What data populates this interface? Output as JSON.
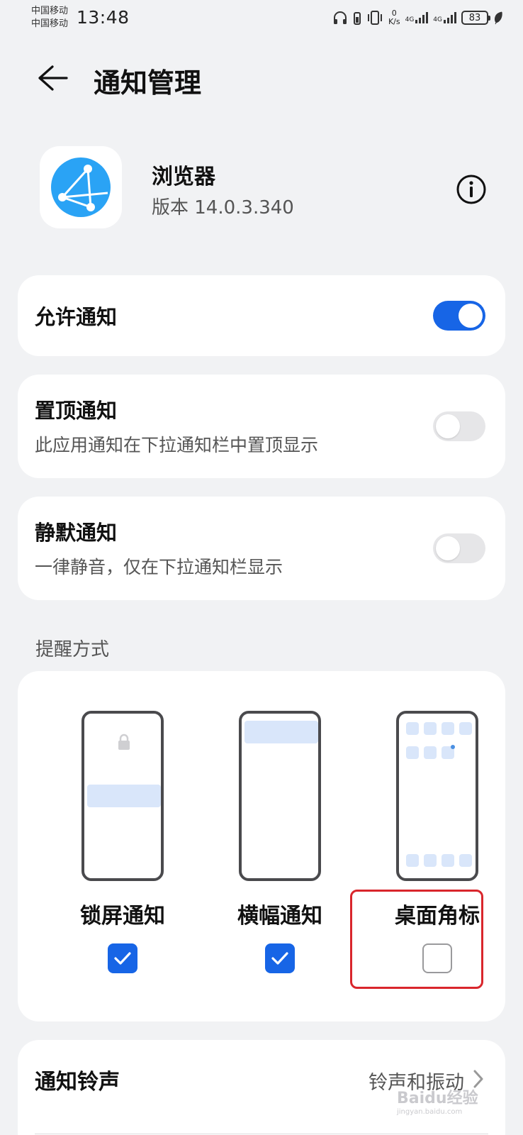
{
  "status_bar": {
    "carrier_1": "中国移动",
    "carrier_2": "中国移动",
    "time": "13:48",
    "net_speed_value": "0",
    "net_speed_unit": "K/s",
    "network_1": "4G",
    "network_2": "4G",
    "battery": "83"
  },
  "header": {
    "title": "通知管理"
  },
  "app": {
    "name": "浏览器",
    "version": "版本 14.0.3.340",
    "icon_color": "#2aa3f5"
  },
  "settings": {
    "allow": {
      "title": "允许通知",
      "enabled": true
    },
    "pinned": {
      "title": "置顶通知",
      "subtitle": "此应用通知在下拉通知栏中置顶显示",
      "enabled": false
    },
    "silent": {
      "title": "静默通知",
      "subtitle": "一律静音，仅在下拉通知栏显示",
      "enabled": false
    }
  },
  "reminder": {
    "section_label": "提醒方式",
    "options": [
      {
        "label": "锁屏通知",
        "checked": true
      },
      {
        "label": "横幅通知",
        "checked": true
      },
      {
        "label": "桌面角标",
        "checked": false
      }
    ]
  },
  "ringtone": {
    "title": "通知铃声",
    "value": "铃声和振动"
  },
  "watermark": {
    "text": "Baidu经验",
    "sub": "jingyan.baidu.com"
  },
  "colors": {
    "accent": "#1765e6",
    "highlight": "#d9262c",
    "background": "#f1f2f4"
  }
}
